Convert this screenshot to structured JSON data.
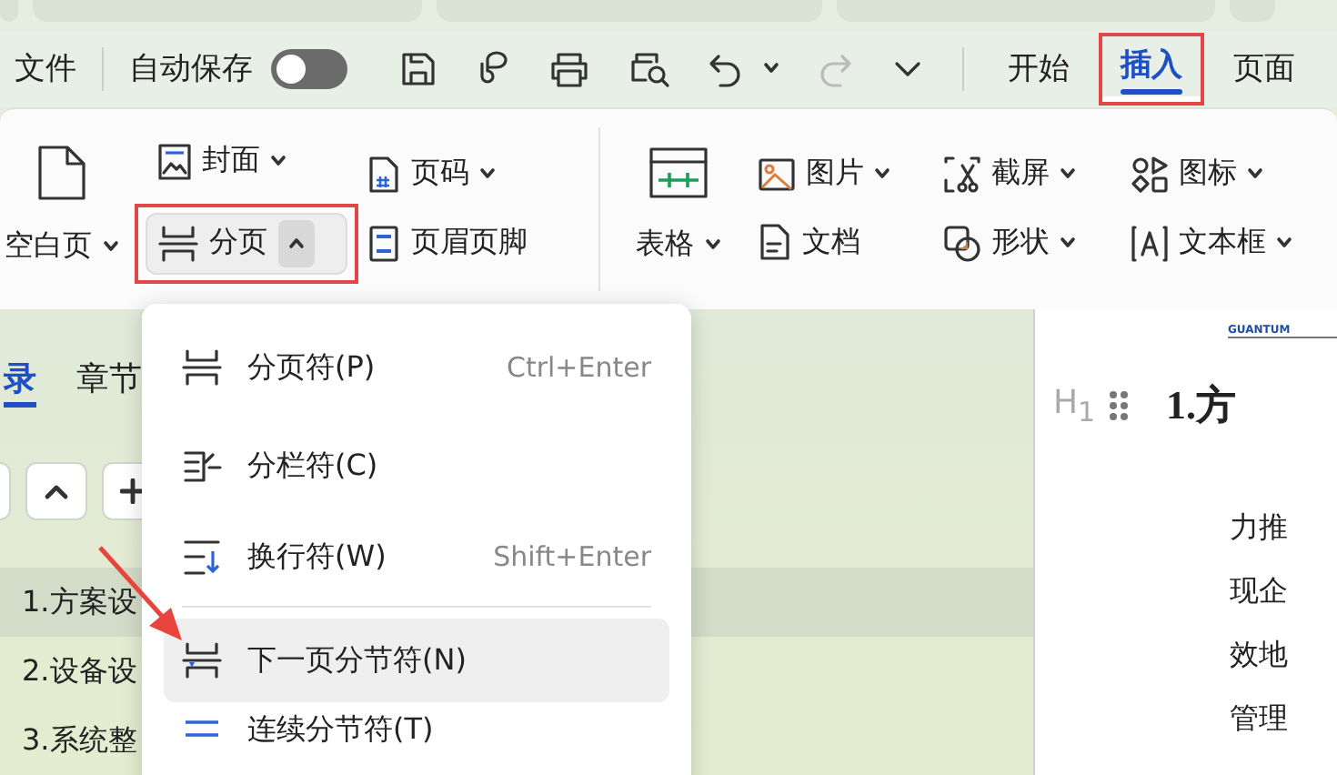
{
  "quick_bar": {
    "file_menu": "文件",
    "autosave": {
      "label": "自动保存",
      "on": false
    }
  },
  "menu_tabs": [
    {
      "label": "开始",
      "selected": false,
      "highlighted": false
    },
    {
      "label": "插入",
      "selected": true,
      "highlighted": true
    },
    {
      "label": "页面",
      "selected": false,
      "highlighted": false
    }
  ],
  "ribbon": {
    "blank_page": {
      "label": "空白页",
      "dropdown": true
    },
    "cover": {
      "label": "封面",
      "dropdown": true
    },
    "page_break": {
      "label": "分页",
      "expanded": true,
      "highlighted": true
    },
    "page_number": {
      "label": "页码",
      "dropdown": true
    },
    "header_footer": {
      "label": "页眉页脚",
      "dropdown": false
    },
    "table": {
      "label": "表格",
      "dropdown": true
    },
    "picture": {
      "label": "图片",
      "dropdown": true
    },
    "document": {
      "label": "文档",
      "dropdown": false
    },
    "screenshot": {
      "label": "截屏",
      "dropdown": true
    },
    "shape": {
      "label": "形状",
      "dropdown": true
    },
    "icons": {
      "label": "图标",
      "dropdown": true
    },
    "text_box": {
      "label": "文本框",
      "dropdown": true
    }
  },
  "nav_panel": {
    "tabs": [
      {
        "label": "录",
        "selected": true
      },
      {
        "label": "章节",
        "selected": false
      }
    ],
    "outline": [
      {
        "label": "1.方案设",
        "selected": true
      },
      {
        "label": "2.设备设",
        "selected": false
      },
      {
        "label": "3.系统整",
        "selected": false
      }
    ]
  },
  "break_menu": {
    "groups": [
      [
        {
          "label": "分页符(P)",
          "shortcut": "Ctrl+Enter",
          "selected": false
        },
        {
          "label": "分栏符(C)",
          "selected": false
        },
        {
          "label": "换行符(W)",
          "shortcut": "Shift+Enter",
          "selected": false
        }
      ],
      [
        {
          "label": "下一页分节符(N)",
          "selected": true
        },
        {
          "label": "连续分节符(T)",
          "selected": false
        }
      ]
    ]
  },
  "document": {
    "logo_text": "GUANTUM",
    "heading_marker": "H$_{1}$",
    "heading": "1.方",
    "lines": [
      "力推",
      "现企",
      "效地",
      "管理"
    ]
  }
}
